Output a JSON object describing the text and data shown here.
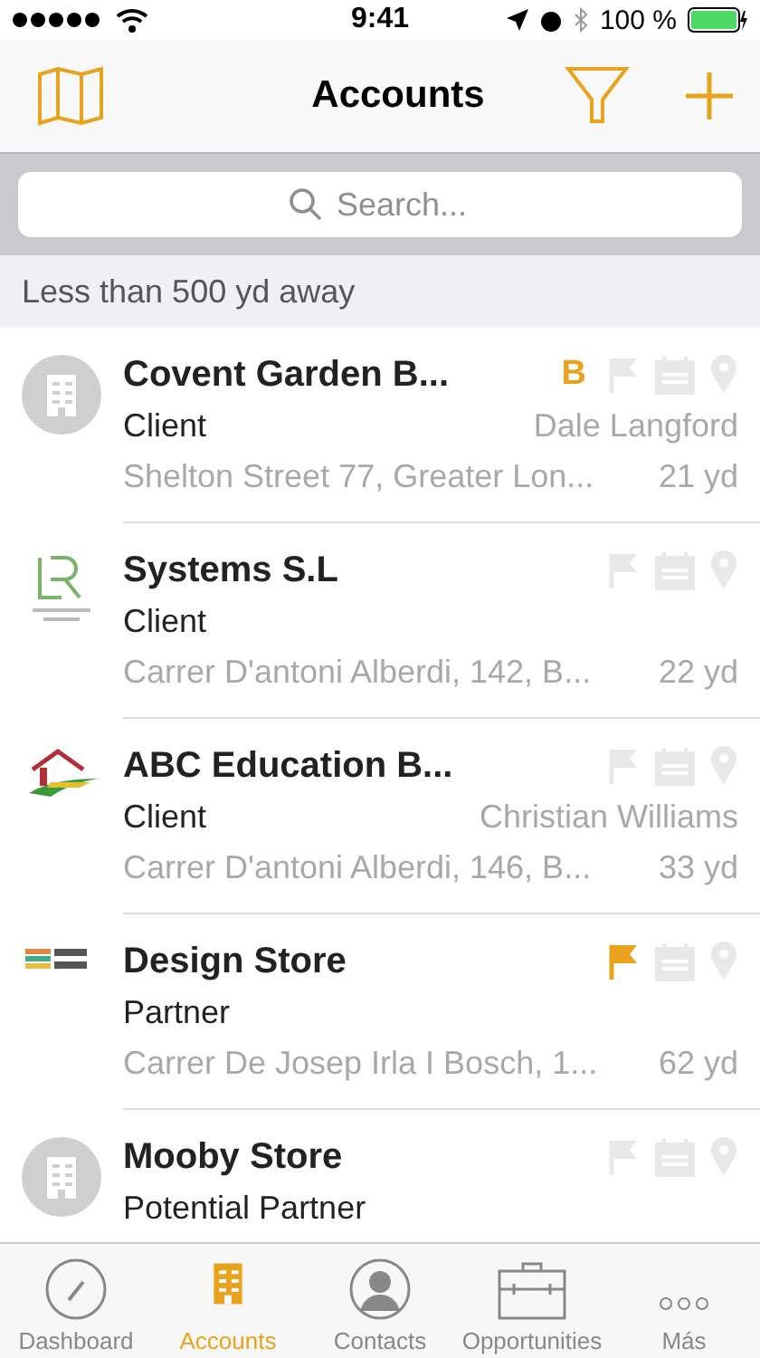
{
  "status_bar": {
    "time": "9:41",
    "battery": "100 %"
  },
  "nav": {
    "title": "Accounts"
  },
  "search": {
    "placeholder": "Search..."
  },
  "section": {
    "title": "Less than 500 yd away"
  },
  "accounts": [
    {
      "kind": "building",
      "name": "Covent Garden B...",
      "type": "Client",
      "badge": "B",
      "contact": "Dale Langford",
      "address": "Shelton Street 77, Greater Lon...",
      "distance": "21 yd",
      "flagged": false
    },
    {
      "kind": "letters",
      "name": "Systems S.L",
      "type": "Client",
      "address": "Carrer D'antoni Alberdi,  142, B...",
      "distance": "22 yd",
      "flagged": false
    },
    {
      "kind": "house",
      "name": "ABC Education B...",
      "type": "Client",
      "contact": "Christian Williams",
      "address": "Carrer D'antoni Alberdi, 146, B...",
      "distance": "33 yd",
      "flagged": false
    },
    {
      "kind": "books",
      "name": "Design Store",
      "type": "Partner",
      "address": "Carrer De Josep Irla I Bosch,  1...",
      "distance": "62 yd",
      "flagged": true
    },
    {
      "kind": "building",
      "name": "Mooby Store",
      "type": "Potential Partner",
      "flagged": false
    }
  ],
  "tabs": [
    {
      "kind": "gauge",
      "label": "Dashboard",
      "selected": false
    },
    {
      "kind": "building",
      "label": "Accounts",
      "selected": true
    },
    {
      "kind": "person",
      "label": "Contacts",
      "selected": false
    },
    {
      "kind": "briefcase",
      "label": "Opportunities",
      "selected": false
    },
    {
      "kind": "more",
      "label": "Más",
      "selected": false
    }
  ]
}
